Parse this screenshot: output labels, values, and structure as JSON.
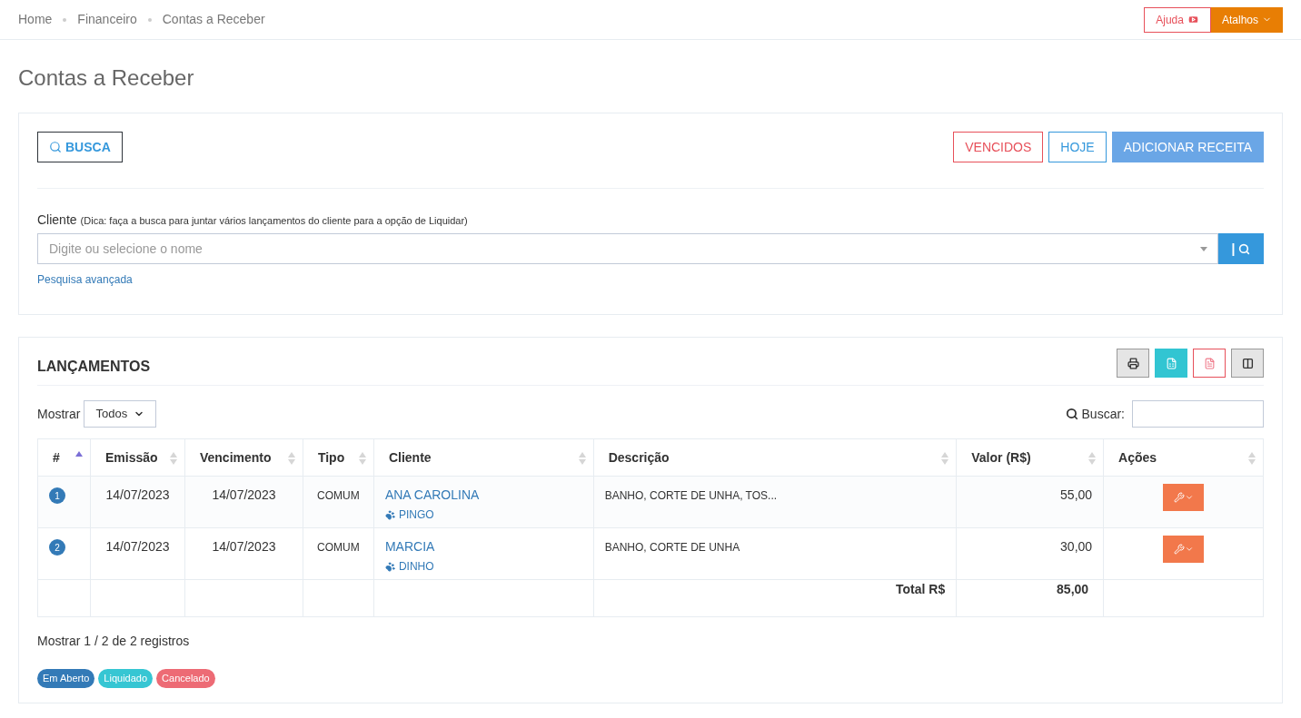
{
  "breadcrumb": [
    "Home",
    "Financeiro",
    "Contas a Receber"
  ],
  "top_buttons": {
    "help": "Ajuda",
    "shortcuts": "Atalhos"
  },
  "page_title": "Contas a Receber",
  "filter_panel": {
    "search_button": "BUSCA",
    "actions": [
      {
        "label": "VENCIDOS",
        "kind": "danger"
      },
      {
        "label": "HOJE",
        "kind": "info"
      },
      {
        "label": "ADICIONAR RECEITA",
        "kind": "primary"
      }
    ],
    "client_label": "Cliente",
    "client_hint": "(Dica: faça a busca para juntar vários lançamentos do cliente para a opção de Liquidar)",
    "client_field": {
      "placeholder": "Digite ou selecione o nome"
    },
    "client_search_button": "|",
    "advanced_link": "Pesquisa avançada"
  },
  "entries_panel": {
    "title": "LANÇAMENTOS",
    "export_buttons": [
      {
        "kind": "print"
      },
      {
        "kind": "excel"
      },
      {
        "kind": "pdf"
      },
      {
        "kind": "columns"
      }
    ],
    "show_label": "Mostrar",
    "show_select": "Todos",
    "search_label": "Buscar:",
    "table": {
      "columns": [
        {
          "label": "#",
          "sorted": true
        },
        {
          "label": "Emissão",
          "sorted": false
        },
        {
          "label": "Vencimento",
          "sorted": false
        },
        {
          "label": "Tipo",
          "sorted": false
        },
        {
          "label": "Cliente",
          "sorted": false
        },
        {
          "label": "Descrição",
          "sorted": false
        },
        {
          "label": "Valor (R$)",
          "sorted": false
        },
        {
          "label": "Ações",
          "sorted": false
        }
      ],
      "rows": [
        {
          "number": "1",
          "color": "#337ab7",
          "issued": "14/07/2023",
          "due": "14/07/2023",
          "type": "COMUM",
          "client": "ANA CAROLINA",
          "pet": "PINGO",
          "description": "BANHO, CORTE DE UNHA, TOS...",
          "value": "55,00"
        },
        {
          "number": "2",
          "color": "#337ab7",
          "issued": "14/07/2023",
          "due": "14/07/2023",
          "type": "COMUM",
          "client": "MARCIA",
          "pet": "DINHO",
          "description": "BANHO, CORTE DE UNHA",
          "value": "30,00"
        }
      ],
      "total_label": "Total R$",
      "total_value": "85,00"
    },
    "summary": "Mostrar 1 / 2 de 2 registros",
    "legend": [
      {
        "label": "Em Aberto",
        "color": "#337ab7"
      },
      {
        "label": "Liquidado",
        "color": "#36c6d3"
      },
      {
        "label": "Cancelado",
        "color": "#ed6b75"
      }
    ]
  }
}
